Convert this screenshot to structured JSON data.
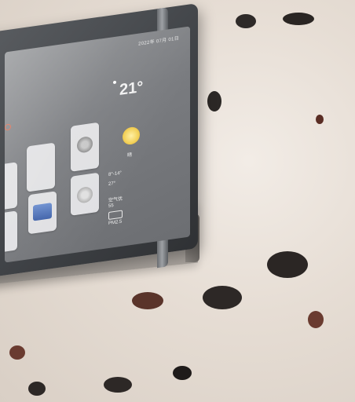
{
  "device": {
    "status_text": "2022年 07月 01日",
    "temperature": "21°",
    "weather_line_1": "晴",
    "weather_line_2": "8°-14°",
    "weather_line_3": "27°",
    "weather_line_4": "空气优",
    "weather_line_5": "55",
    "weather_line_6": "PM2.5"
  },
  "colors": {
    "accent": "#e06b4d",
    "screen": "#7a7c80",
    "frame": "#3f4246",
    "wall": "#e6ddd4"
  }
}
